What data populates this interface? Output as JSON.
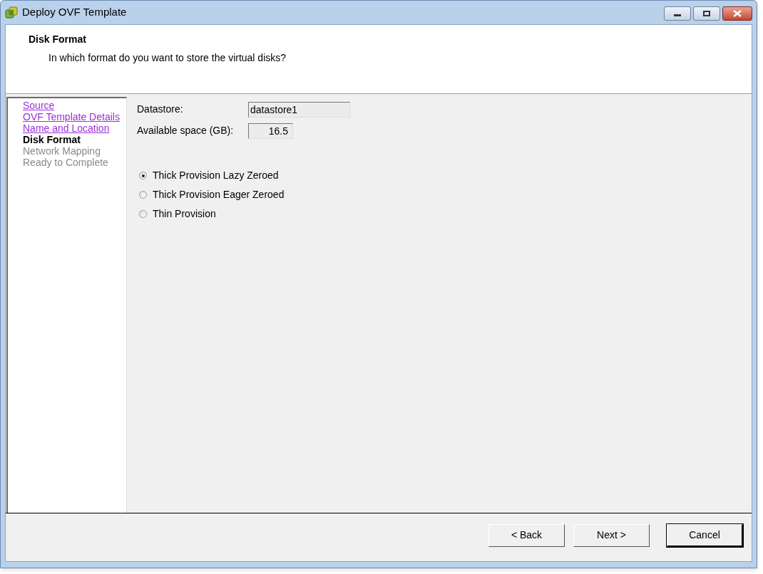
{
  "window": {
    "title": "Deploy OVF Template"
  },
  "header": {
    "title": "Disk Format",
    "subtitle": "In which format do you want to store the virtual disks?"
  },
  "steps": [
    {
      "label": "Source",
      "kind": "done"
    },
    {
      "label": "OVF Template Details",
      "kind": "done"
    },
    {
      "label": "Name and Location",
      "kind": "done"
    },
    {
      "label": "Disk Format",
      "kind": "current"
    },
    {
      "label": "Network Mapping",
      "kind": "upcoming"
    },
    {
      "label": "Ready to Complete",
      "kind": "upcoming"
    }
  ],
  "fields": [
    {
      "label": "Datastore:",
      "value": "datastore1",
      "kind": "text"
    },
    {
      "label": "Available space (GB):",
      "value": "16.5",
      "kind": "number"
    }
  ],
  "formats": [
    {
      "label": "Thick Provision Lazy Zeroed",
      "selected": true
    },
    {
      "label": "Thick Provision Eager Zeroed",
      "selected": false
    },
    {
      "label": "Thin Provision",
      "selected": false
    }
  ],
  "buttons": [
    {
      "label": "< Back",
      "default": false
    },
    {
      "label": "Next >",
      "default": false
    },
    {
      "label": "Cancel",
      "default": true
    }
  ]
}
